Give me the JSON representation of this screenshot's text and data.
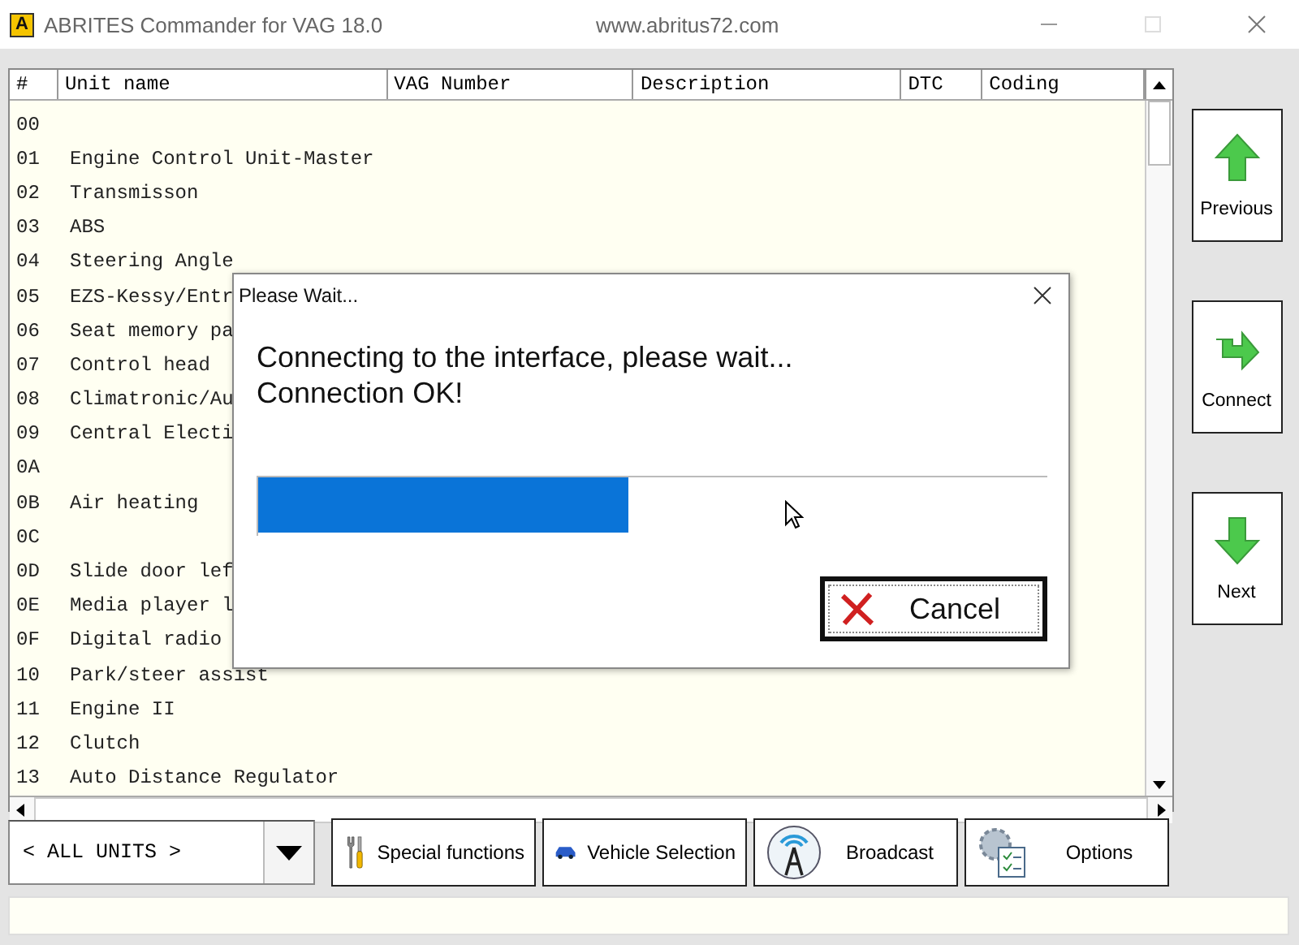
{
  "window": {
    "logo": "A",
    "title": "ABRITES Commander for VAG 18.0",
    "url": "www.abritus72.com"
  },
  "table": {
    "columns": [
      "#",
      "Unit name",
      "VAG Number",
      "Description",
      "DTC",
      "Coding"
    ],
    "rows": [
      {
        "num": "00",
        "name": ""
      },
      {
        "num": "01",
        "name": "Engine Control Unit-Master"
      },
      {
        "num": "02",
        "name": "Transmisson"
      },
      {
        "num": "03",
        "name": "ABS"
      },
      {
        "num": "04",
        "name": "Steering Angle"
      },
      {
        "num": "05",
        "name": "EZS-Kessy/Entr"
      },
      {
        "num": "06",
        "name": "Seat memory pa"
      },
      {
        "num": "07",
        "name": "Control head"
      },
      {
        "num": "08",
        "name": "Climatronic/Au"
      },
      {
        "num": "09",
        "name": "Central Electi"
      },
      {
        "num": "0A",
        "name": ""
      },
      {
        "num": "0B",
        "name": "Air heating"
      },
      {
        "num": "0C",
        "name": ""
      },
      {
        "num": "0D",
        "name": "Slide door lef"
      },
      {
        "num": "0E",
        "name": "Media player l"
      },
      {
        "num": "0F",
        "name": "Digital radio"
      },
      {
        "num": "10",
        "name": "Park/steer assist"
      },
      {
        "num": "11",
        "name": "Engine II"
      },
      {
        "num": "12",
        "name": "Clutch"
      },
      {
        "num": "13",
        "name": "Auto Distance Regulator"
      }
    ]
  },
  "side_buttons": [
    {
      "kind": "up",
      "label": "Previous"
    },
    {
      "kind": "right",
      "label": "Connect"
    },
    {
      "kind": "down",
      "label": "Next"
    }
  ],
  "unit_filter": {
    "value": "< ALL UNITS >"
  },
  "toolbar": [
    {
      "kind": "tools",
      "label": "Special functions"
    },
    {
      "kind": "car",
      "label": "Vehicle Selection"
    },
    {
      "kind": "antenna",
      "label": "Broadcast"
    },
    {
      "kind": "options",
      "label": "Options"
    }
  ],
  "dialog": {
    "title": "Please Wait...",
    "message": [
      "Connecting to the interface, please wait...",
      "Connection OK!"
    ],
    "progress": {
      "level": 0.47
    },
    "button": "Cancel"
  }
}
